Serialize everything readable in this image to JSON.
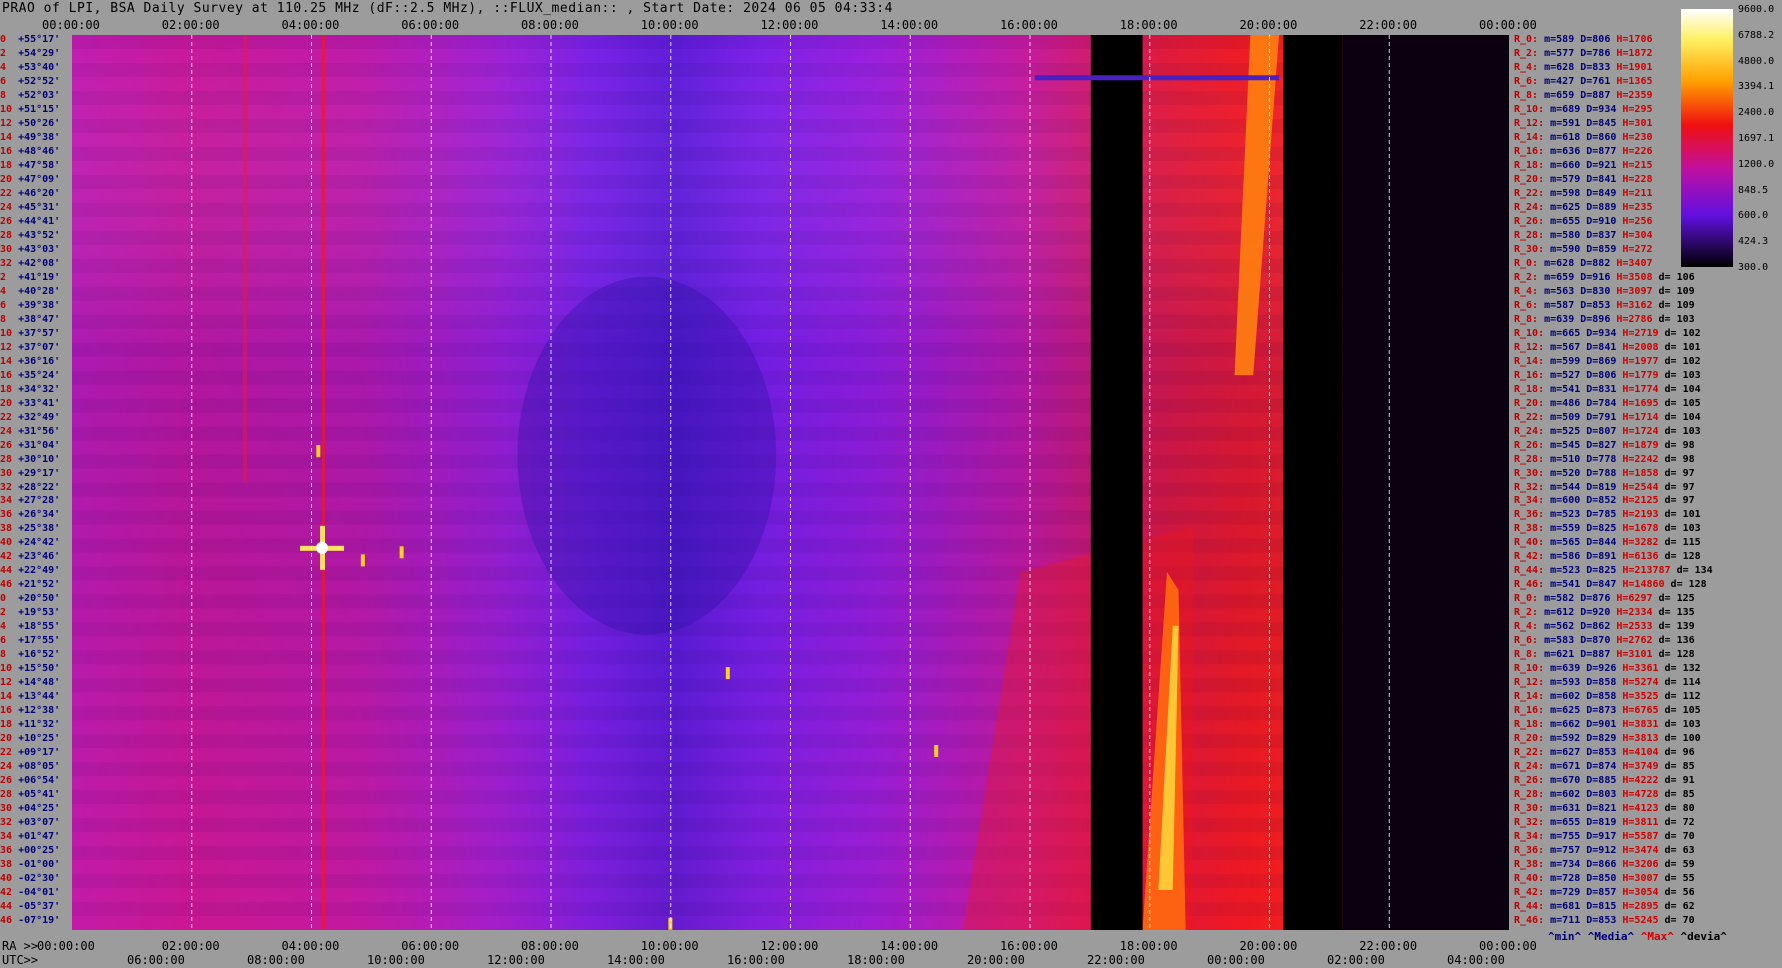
{
  "title": "PRAO of LPI, BSA Daily Survey at 110.25 MHz (dF::2.5 MHz), ::FLUX_median:: , Start Date: 2024 06 05 04:33:4",
  "top_axis": [
    "00:00:00",
    "02:00:00",
    "04:00:00",
    "06:00:00",
    "08:00:00",
    "10:00:00",
    "12:00:00",
    "14:00:00",
    "16:00:00",
    "18:00:00",
    "20:00:00",
    "22:00:00",
    "00:00:00"
  ],
  "ra_prefix": "RA >>",
  "ra_axis": [
    "00:00:00",
    "02:00:00",
    "04:00:00",
    "06:00:00",
    "08:00:00",
    "10:00:00",
    "12:00:00",
    "14:00:00",
    "16:00:00",
    "18:00:00",
    "20:00:00",
    "22:00:00",
    "00:00:00"
  ],
  "utc_prefix": "UTC>>",
  "utc_axis": [
    "06:00:00",
    "08:00:00",
    "10:00:00",
    "12:00:00",
    "14:00:00",
    "16:00:00",
    "18:00:00",
    "20:00:00",
    "22:00:00",
    "00:00:00",
    "02:00:00",
    "04:00:00"
  ],
  "declinations": [
    {
      "i": "0",
      "d": "+55°17'"
    },
    {
      "i": "2",
      "d": "+54°29'"
    },
    {
      "i": "4",
      "d": "+53°40'"
    },
    {
      "i": "6",
      "d": "+52°52'"
    },
    {
      "i": "8",
      "d": "+52°03'"
    },
    {
      "i": "10",
      "d": "+51°15'"
    },
    {
      "i": "12",
      "d": "+50°26'"
    },
    {
      "i": "14",
      "d": "+49°38'"
    },
    {
      "i": "16",
      "d": "+48°46'"
    },
    {
      "i": "18",
      "d": "+47°58'"
    },
    {
      "i": "20",
      "d": "+47°09'"
    },
    {
      "i": "22",
      "d": "+46°20'"
    },
    {
      "i": "24",
      "d": "+45°31'"
    },
    {
      "i": "26",
      "d": "+44°41'"
    },
    {
      "i": "28",
      "d": "+43°52'"
    },
    {
      "i": "30",
      "d": "+43°03'"
    },
    {
      "i": "32",
      "d": "+42°08'"
    },
    {
      "i": "2",
      "d": "+41°19'"
    },
    {
      "i": "4",
      "d": "+40°28'"
    },
    {
      "i": "6",
      "d": "+39°38'"
    },
    {
      "i": "8",
      "d": "+38°47'"
    },
    {
      "i": "10",
      "d": "+37°57'"
    },
    {
      "i": "12",
      "d": "+37°07'"
    },
    {
      "i": "14",
      "d": "+36°16'"
    },
    {
      "i": "16",
      "d": "+35°24'"
    },
    {
      "i": "18",
      "d": "+34°32'"
    },
    {
      "i": "20",
      "d": "+33°41'"
    },
    {
      "i": "22",
      "d": "+32°49'"
    },
    {
      "i": "24",
      "d": "+31°56'"
    },
    {
      "i": "26",
      "d": "+31°04'"
    },
    {
      "i": "28",
      "d": "+30°10'"
    },
    {
      "i": "30",
      "d": "+29°17'"
    },
    {
      "i": "32",
      "d": "+28°22'"
    },
    {
      "i": "34",
      "d": "+27°28'"
    },
    {
      "i": "36",
      "d": "+26°34'"
    },
    {
      "i": "38",
      "d": "+25°38'"
    },
    {
      "i": "40",
      "d": "+24°42'"
    },
    {
      "i": "42",
      "d": "+23°46'"
    },
    {
      "i": "44",
      "d": "+22°49'"
    },
    {
      "i": "46",
      "d": "+21°52'"
    },
    {
      "i": "0",
      "d": "+20°50'"
    },
    {
      "i": "2",
      "d": "+19°53'"
    },
    {
      "i": "4",
      "d": "+18°55'"
    },
    {
      "i": "6",
      "d": "+17°55'"
    },
    {
      "i": "8",
      "d": "+16°52'"
    },
    {
      "i": "10",
      "d": "+15°50'"
    },
    {
      "i": "12",
      "d": "+14°48'"
    },
    {
      "i": "14",
      "d": "+13°44'"
    },
    {
      "i": "16",
      "d": "+12°38'"
    },
    {
      "i": "18",
      "d": "+11°32'"
    },
    {
      "i": "20",
      "d": "+10°25'"
    },
    {
      "i": "22",
      "d": "+09°17'"
    },
    {
      "i": "24",
      "d": "+08°05'"
    },
    {
      "i": "26",
      "d": "+06°54'"
    },
    {
      "i": "28",
      "d": "+05°41'"
    },
    {
      "i": "30",
      "d": "+04°25'"
    },
    {
      "i": "32",
      "d": "+03°07'"
    },
    {
      "i": "34",
      "d": "+01°47'"
    },
    {
      "i": "36",
      "d": "+00°25'"
    },
    {
      "i": "38",
      "d": "-01°00'"
    },
    {
      "i": "40",
      "d": "-02°30'"
    },
    {
      "i": "42",
      "d": "-04°01'"
    },
    {
      "i": "44",
      "d": "-05°37'"
    },
    {
      "i": "46",
      "d": "-07°19'"
    }
  ],
  "row_stats": [
    {
      "r": "R_0:",
      "m": "m=589",
      "d": "D=806",
      "h": "H=1706",
      "dv": ""
    },
    {
      "r": "R_2:",
      "m": "m=577",
      "d": "D=786",
      "h": "H=1872",
      "dv": ""
    },
    {
      "r": "R_4:",
      "m": "m=628",
      "d": "D=833",
      "h": "H=1901",
      "dv": ""
    },
    {
      "r": "R_6:",
      "m": "m=427",
      "d": "D=761",
      "h": "H=1365",
      "dv": ""
    },
    {
      "r": "R_8:",
      "m": "m=659",
      "d": "D=887",
      "h": "H=2359",
      "dv": ""
    },
    {
      "r": "R_10:",
      "m": "m=689",
      "d": "D=934",
      "h": "H=295",
      "dv": ""
    },
    {
      "r": "R_12:",
      "m": "m=591",
      "d": "D=845",
      "h": "H=301",
      "dv": ""
    },
    {
      "r": "R_14:",
      "m": "m=618",
      "d": "D=860",
      "h": "H=230",
      "dv": ""
    },
    {
      "r": "R_16:",
      "m": "m=636",
      "d": "D=877",
      "h": "H=226",
      "dv": ""
    },
    {
      "r": "R_18:",
      "m": "m=660",
      "d": "D=921",
      "h": "H=215",
      "dv": ""
    },
    {
      "r": "R_20:",
      "m": "m=579",
      "d": "D=841",
      "h": "H=228",
      "dv": ""
    },
    {
      "r": "R_22:",
      "m": "m=598",
      "d": "D=849",
      "h": "H=211",
      "dv": ""
    },
    {
      "r": "R_24:",
      "m": "m=625",
      "d": "D=889",
      "h": "H=235",
      "dv": ""
    },
    {
      "r": "R_26:",
      "m": "m=655",
      "d": "D=910",
      "h": "H=256",
      "dv": ""
    },
    {
      "r": "R_28:",
      "m": "m=580",
      "d": "D=837",
      "h": "H=304",
      "dv": ""
    },
    {
      "r": "R_30:",
      "m": "m=590",
      "d": "D=859",
      "h": "H=272",
      "dv": ""
    },
    {
      "r": "R_0:",
      "m": "m=628",
      "d": "D=882",
      "h": "H=3407",
      "dv": ""
    },
    {
      "r": "R_2:",
      "m": "m=659",
      "d": "D=916",
      "h": "H=3508",
      "dv": "d= 106"
    },
    {
      "r": "R_4:",
      "m": "m=563",
      "d": "D=830",
      "h": "H=3097",
      "dv": "d= 109"
    },
    {
      "r": "R_6:",
      "m": "m=587",
      "d": "D=853",
      "h": "H=3162",
      "dv": "d= 109"
    },
    {
      "r": "R_8:",
      "m": "m=639",
      "d": "D=896",
      "h": "H=2786",
      "dv": "d= 103"
    },
    {
      "r": "R_10:",
      "m": "m=665",
      "d": "D=934",
      "h": "H=2719",
      "dv": "d= 102"
    },
    {
      "r": "R_12:",
      "m": "m=567",
      "d": "D=841",
      "h": "H=2008",
      "dv": "d= 101"
    },
    {
      "r": "R_14:",
      "m": "m=599",
      "d": "D=869",
      "h": "H=1977",
      "dv": "d= 102"
    },
    {
      "r": "R_16:",
      "m": "m=527",
      "d": "D=806",
      "h": "H=1779",
      "dv": "d= 103"
    },
    {
      "r": "R_18:",
      "m": "m=541",
      "d": "D=831",
      "h": "H=1774",
      "dv": "d= 104"
    },
    {
      "r": "R_20:",
      "m": "m=486",
      "d": "D=784",
      "h": "H=1695",
      "dv": "d= 105"
    },
    {
      "r": "R_22:",
      "m": "m=509",
      "d": "D=791",
      "h": "H=1714",
      "dv": "d= 104"
    },
    {
      "r": "R_24:",
      "m": "m=525",
      "d": "D=807",
      "h": "H=1724",
      "dv": "d= 103"
    },
    {
      "r": "R_26:",
      "m": "m=545",
      "d": "D=827",
      "h": "H=1879",
      "dv": "d= 98"
    },
    {
      "r": "R_28:",
      "m": "m=510",
      "d": "D=778",
      "h": "H=2242",
      "dv": "d= 98"
    },
    {
      "r": "R_30:",
      "m": "m=520",
      "d": "D=788",
      "h": "H=1858",
      "dv": "d= 97"
    },
    {
      "r": "R_32:",
      "m": "m=544",
      "d": "D=819",
      "h": "H=2544",
      "dv": "d= 97"
    },
    {
      "r": "R_34:",
      "m": "m=600",
      "d": "D=852",
      "h": "H=2125",
      "dv": "d= 97"
    },
    {
      "r": "R_36:",
      "m": "m=523",
      "d": "D=785",
      "h": "H=2193",
      "dv": "d= 101"
    },
    {
      "r": "R_38:",
      "m": "m=559",
      "d": "D=825",
      "h": "H=1678",
      "dv": "d= 103"
    },
    {
      "r": "R_40:",
      "m": "m=565",
      "d": "D=844",
      "h": "H=3282",
      "dv": "d= 115"
    },
    {
      "r": "R_42:",
      "m": "m=586",
      "d": "D=891",
      "h": "H=6136",
      "dv": "d= 128"
    },
    {
      "r": "R_44:",
      "m": "m=523",
      "d": "D=825",
      "h": "H=213787",
      "dv": "d= 134"
    },
    {
      "r": "R_46:",
      "m": "m=541",
      "d": "D=847",
      "h": "H=14860",
      "dv": "d= 128"
    },
    {
      "r": "R_0:",
      "m": "m=582",
      "d": "D=876",
      "h": "H=6297",
      "dv": "d= 125"
    },
    {
      "r": "R_2:",
      "m": "m=612",
      "d": "D=920",
      "h": "H=2334",
      "dv": "d= 135"
    },
    {
      "r": "R_4:",
      "m": "m=562",
      "d": "D=862",
      "h": "H=2533",
      "dv": "d= 139"
    },
    {
      "r": "R_6:",
      "m": "m=583",
      "d": "D=870",
      "h": "H=2762",
      "dv": "d= 136"
    },
    {
      "r": "R_8:",
      "m": "m=621",
      "d": "D=887",
      "h": "H=3101",
      "dv": "d= 128"
    },
    {
      "r": "R_10:",
      "m": "m=639",
      "d": "D=926",
      "h": "H=3361",
      "dv": "d= 132"
    },
    {
      "r": "R_12:",
      "m": "m=593",
      "d": "D=858",
      "h": "H=5274",
      "dv": "d= 114"
    },
    {
      "r": "R_14:",
      "m": "m=602",
      "d": "D=858",
      "h": "H=3525",
      "dv": "d= 112"
    },
    {
      "r": "R_16:",
      "m": "m=625",
      "d": "D=873",
      "h": "H=6765",
      "dv": "d= 105"
    },
    {
      "r": "R_18:",
      "m": "m=662",
      "d": "D=901",
      "h": "H=3831",
      "dv": "d= 103"
    },
    {
      "r": "R_20:",
      "m": "m=592",
      "d": "D=829",
      "h": "H=3813",
      "dv": "d= 100"
    },
    {
      "r": "R_22:",
      "m": "m=627",
      "d": "D=853",
      "h": "H=4104",
      "dv": "d= 96"
    },
    {
      "r": "R_24:",
      "m": "m=671",
      "d": "D=874",
      "h": "H=3749",
      "dv": "d= 85"
    },
    {
      "r": "R_26:",
      "m": "m=670",
      "d": "D=885",
      "h": "H=4222",
      "dv": "d= 91"
    },
    {
      "r": "R_28:",
      "m": "m=602",
      "d": "D=803",
      "h": "H=4728",
      "dv": "d= 85"
    },
    {
      "r": "R_30:",
      "m": "m=631",
      "d": "D=821",
      "h": "H=4123",
      "dv": "d= 80"
    },
    {
      "r": "R_32:",
      "m": "m=655",
      "d": "D=819",
      "h": "H=3811",
      "dv": "d= 72"
    },
    {
      "r": "R_34:",
      "m": "m=755",
      "d": "D=917",
      "h": "H=5587",
      "dv": "d= 70"
    },
    {
      "r": "R_36:",
      "m": "m=757",
      "d": "D=912",
      "h": "H=3474",
      "dv": "d= 63"
    },
    {
      "r": "R_38:",
      "m": "m=734",
      "d": "D=866",
      "h": "H=3206",
      "dv": "d= 59"
    },
    {
      "r": "R_40:",
      "m": "m=728",
      "d": "D=850",
      "h": "H=3007",
      "dv": "d= 55"
    },
    {
      "r": "R_42:",
      "m": "m=729",
      "d": "D=857",
      "h": "H=3054",
      "dv": "d= 56"
    },
    {
      "r": "R_44:",
      "m": "m=681",
      "d": "D=815",
      "h": "H=2895",
      "dv": "d= 62"
    },
    {
      "r": "R_46:",
      "m": "m=711",
      "d": "D=853",
      "h": "H=5245",
      "dv": "d= 70"
    }
  ],
  "colorbar_ticks": [
    "9600.0",
    "6788.2",
    "4800.0",
    "3394.1",
    "2400.0",
    "1697.1",
    "1200.0",
    "848.5",
    "600.0",
    "424.3",
    "300.0"
  ],
  "legend": {
    "min": "^min^",
    "median": "^Media^",
    "max": "^Max^",
    "devia": "^devia^"
  },
  "colors": {
    "background": "#9c9c9c",
    "sky_violet": "#8a1cf0",
    "sky_magenta": "#c01aa8",
    "sky_red": "#e81a40",
    "gap": "#000000",
    "grid": "#ffffff"
  }
}
